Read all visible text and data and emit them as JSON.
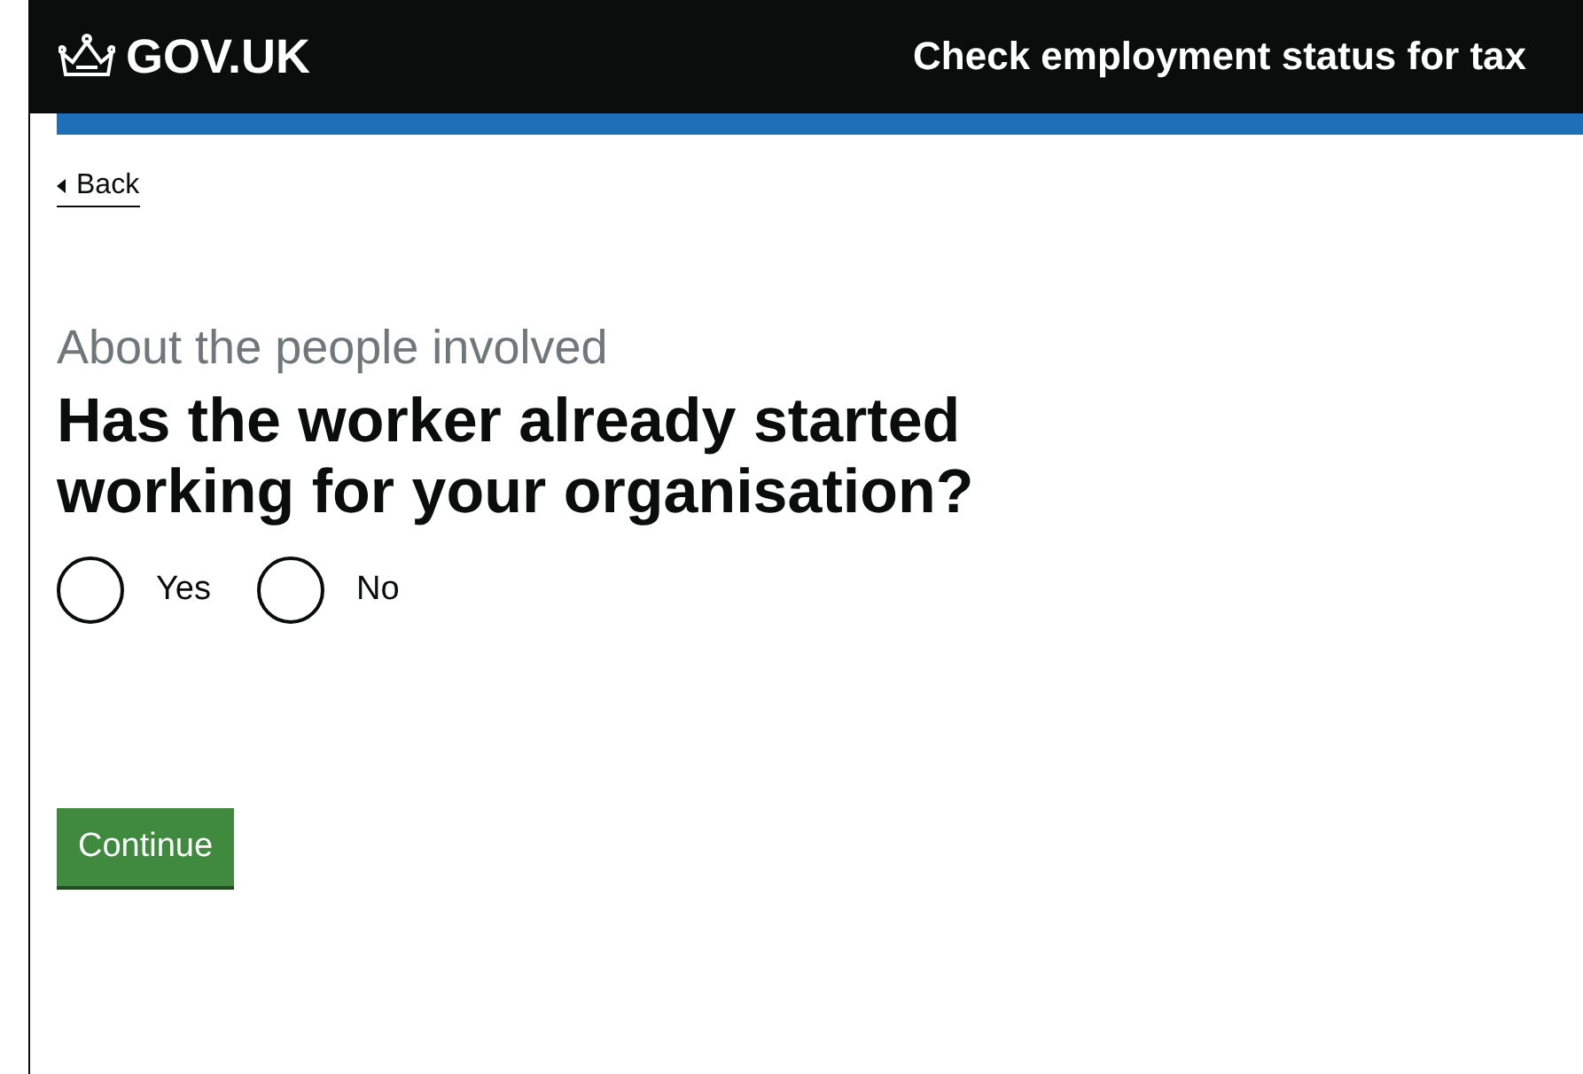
{
  "header": {
    "logo": "GOV.UK",
    "service_name": "Check employment status for tax"
  },
  "back_link": "Back",
  "caption": "About the people involved",
  "question": "Has the worker already started working for your organisation?",
  "options": [
    {
      "label": "Yes",
      "selected": false
    },
    {
      "label": "No",
      "selected": false
    }
  ],
  "button": "Continue"
}
